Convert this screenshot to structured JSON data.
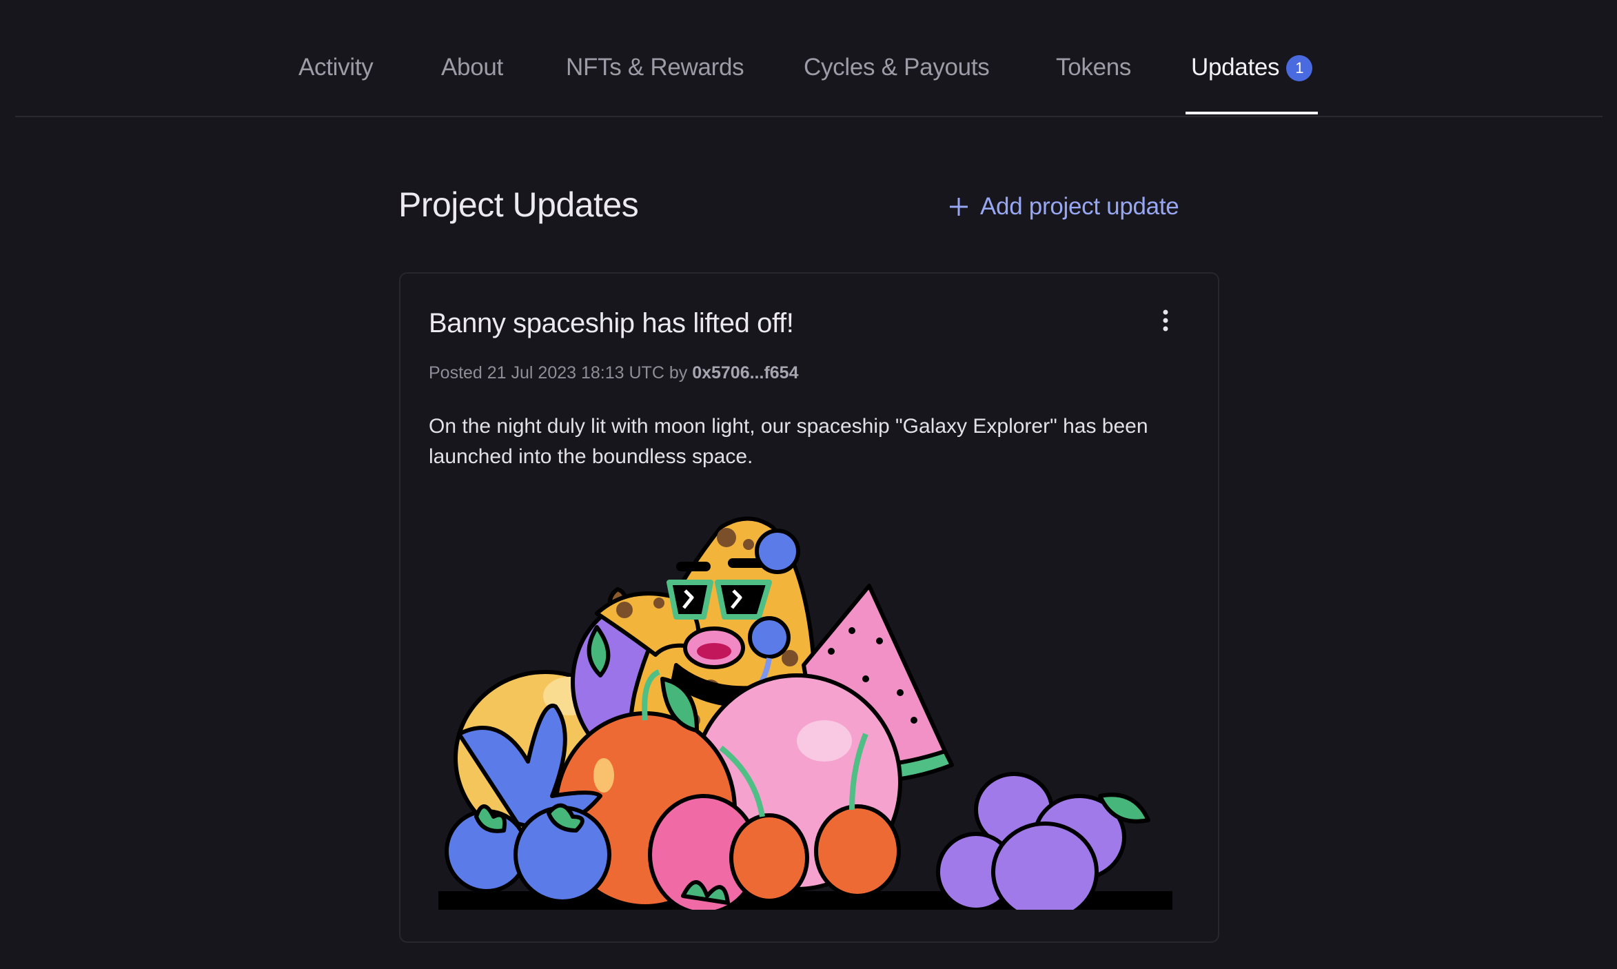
{
  "tabs": [
    {
      "label": "Activity",
      "active": false
    },
    {
      "label": "About",
      "active": false
    },
    {
      "label": "NFTs & Rewards",
      "active": false
    },
    {
      "label": "Cycles & Payouts",
      "active": false
    },
    {
      "label": "Tokens",
      "active": false
    },
    {
      "label": "Updates",
      "active": true,
      "badge": "1"
    }
  ],
  "header": {
    "title": "Project Updates",
    "add_button_label": "Add project update",
    "add_icon": "plus-icon"
  },
  "update": {
    "title": "Banny spaceship has lifted off!",
    "menu_icon": "kebab-menu-icon",
    "posted_prefix": "Posted 21 Jul 2023 18:13 UTC by",
    "author": "0x5706...f654",
    "body": "On the night duly lit with moon light, our spaceship \"Galaxy Explorer\" has been launched into the boundless space.",
    "image_alt": "Banny character with sunglasses and headphones among colorful fruits"
  },
  "colors": {
    "background": "#17161c",
    "accent": "#98a7f2",
    "badge": "#4a6ae0"
  }
}
